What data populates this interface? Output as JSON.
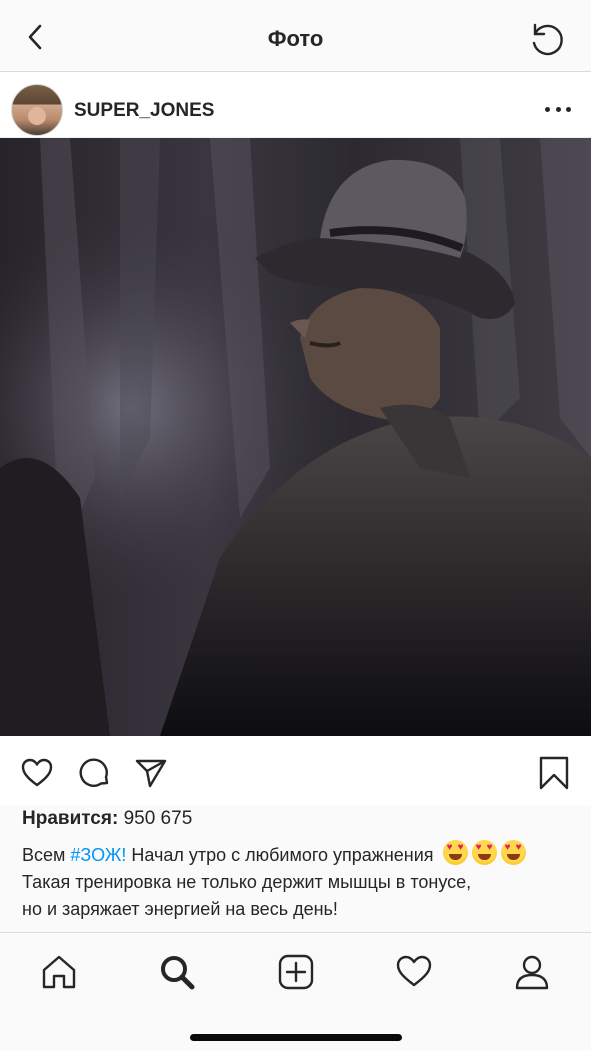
{
  "header": {
    "title": "Фото",
    "back_icon": "chevron-left-icon",
    "refresh_icon": "refresh-icon"
  },
  "post": {
    "username": "SUPER_JONES",
    "avatar_icon": "profile-avatar",
    "more_icon": "more-horizontal-icon",
    "photo_alt": "man-in-fedora-photo"
  },
  "actions": {
    "like_icon": "heart-icon",
    "comment_icon": "comment-icon",
    "share_icon": "send-icon",
    "save_icon": "bookmark-icon"
  },
  "likes": {
    "label": "Нравится:",
    "count": "950 675"
  },
  "caption": {
    "prefix": "Всем ",
    "hashtag": "#ЗОЖ!",
    "line1_rest": " Начал утро с любимого упражнения",
    "emoji_name": "heart-eyes-emoji",
    "line2": "Такая тренировка не только держит мышцы в тонусе,",
    "line3": "но и заряжает энергией на весь день!"
  },
  "tabbar": {
    "items": [
      "home-icon",
      "search-icon",
      "add-post-icon",
      "activity-heart-icon",
      "profile-icon"
    ]
  },
  "colors": {
    "accent": "#0095f6",
    "text": "#262626",
    "background": "#fafafa"
  }
}
